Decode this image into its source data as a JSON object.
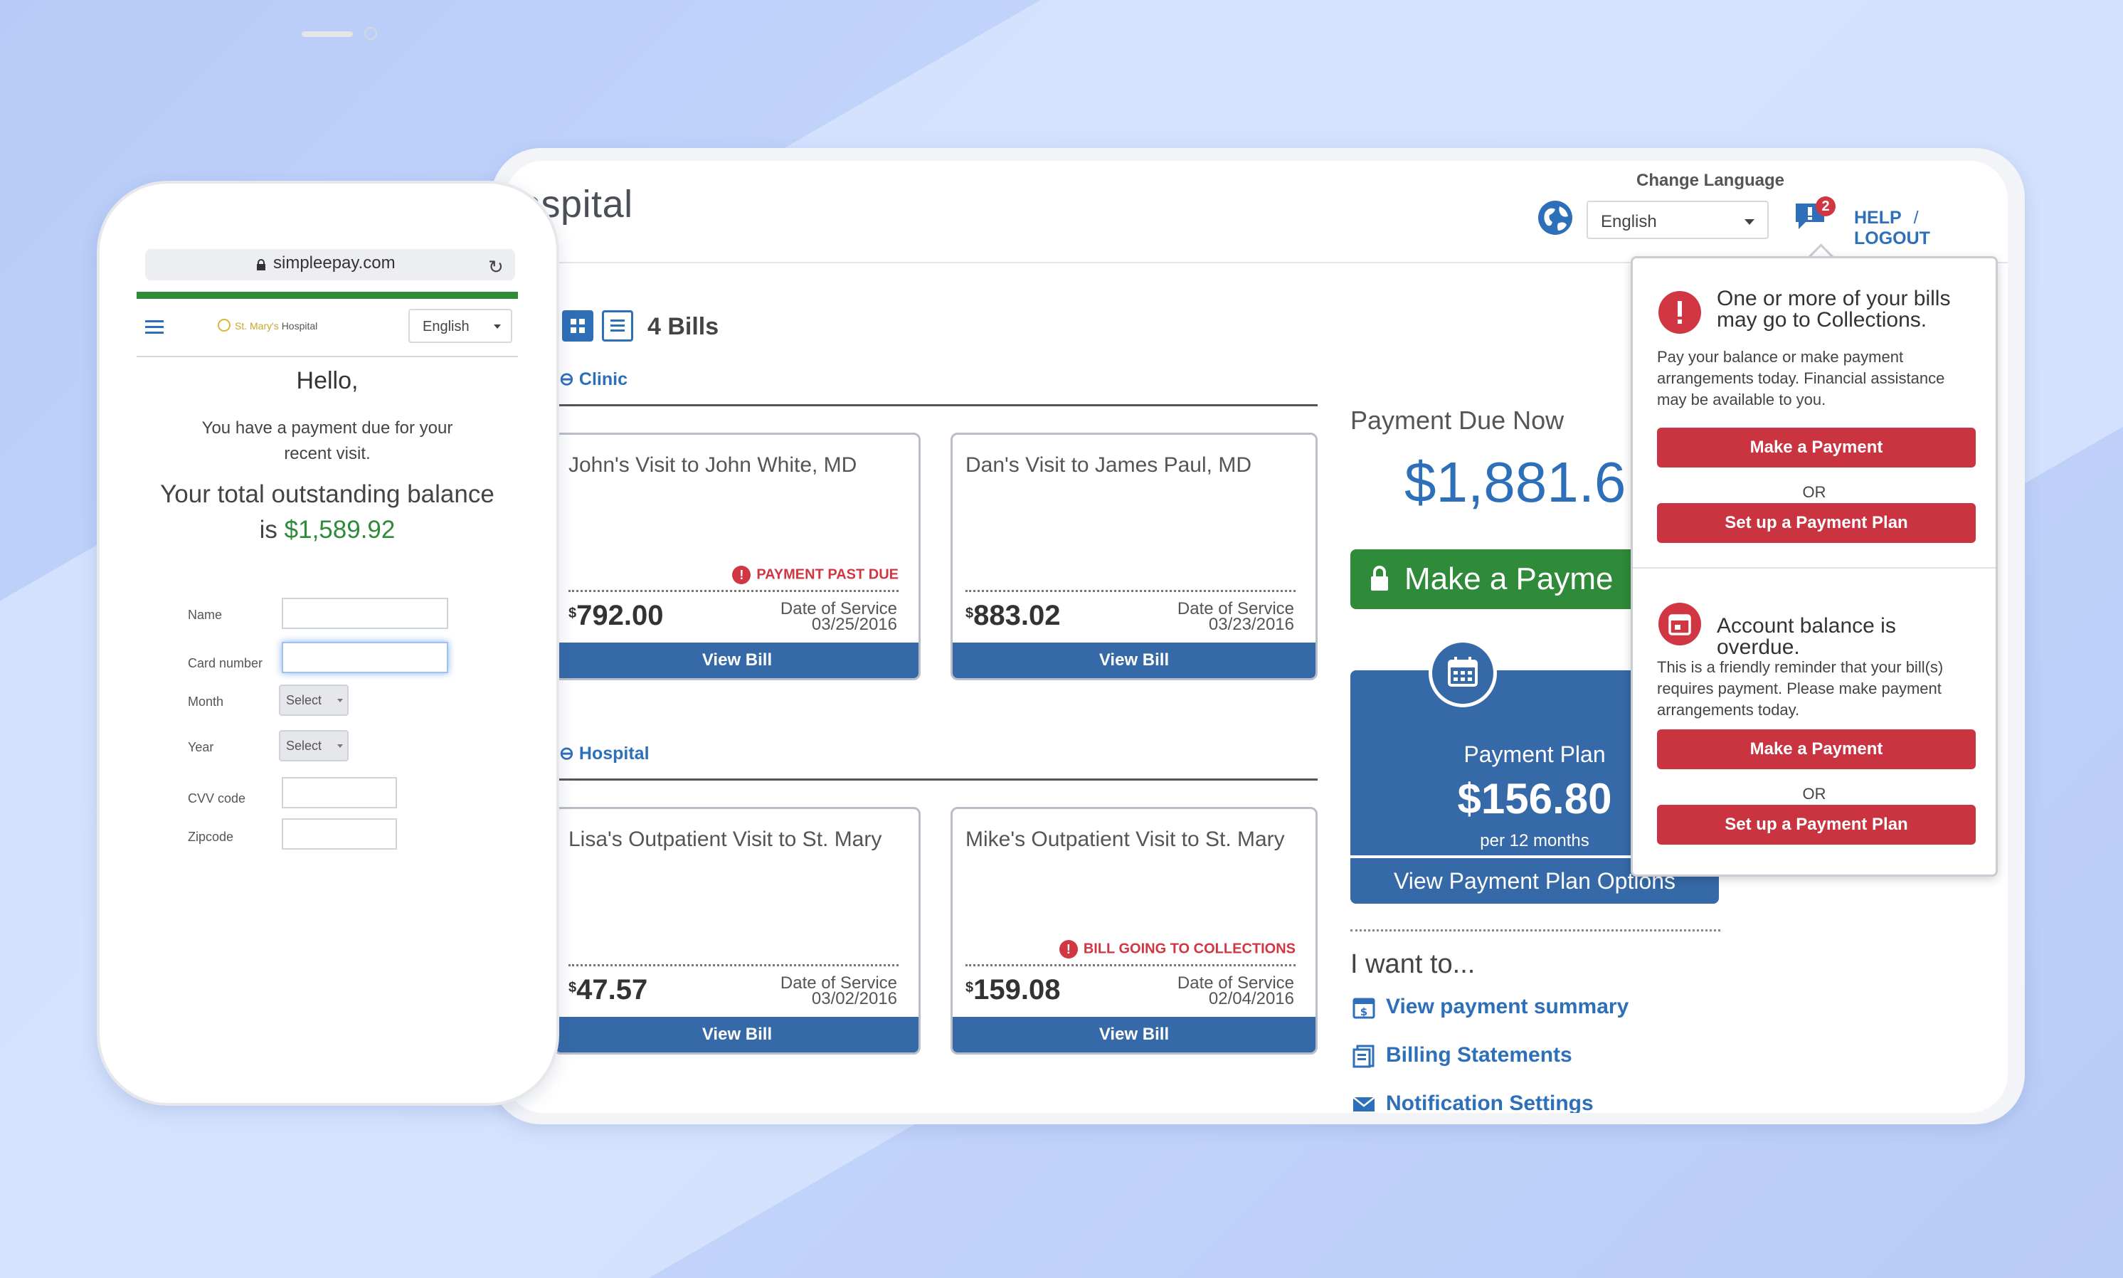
{
  "desktop": {
    "brand": "ospital",
    "change_language_label": "Change Language",
    "language_selected": "English",
    "alert_count": "2",
    "help_label": "HELP",
    "separator": "/",
    "logout_label": "LOGOUT",
    "bills_count": "4 Bills",
    "sections": [
      {
        "label": "Clinic"
      },
      {
        "label": "Hospital"
      }
    ],
    "bills": [
      {
        "title": "John's Visit to John White, MD",
        "flag": "PAYMENT PAST DUE",
        "currency": "$",
        "amount": "792.00",
        "dos_label": "Date of Service",
        "dos": "03/25/2016",
        "button": "View Bill"
      },
      {
        "title": "Dan's Visit to James Paul, MD",
        "flag": "",
        "currency": "$",
        "amount": "883.02",
        "dos_label": "Date of Service",
        "dos": "03/23/2016",
        "button": "View Bill"
      },
      {
        "title": "Lisa's Outpatient Visit to St. Mary",
        "flag": "",
        "currency": "$",
        "amount": "47.57",
        "dos_label": "Date of Service",
        "dos": "03/02/2016",
        "button": "View Bill"
      },
      {
        "title": "Mike's Outpatient Visit to St. Mary",
        "flag": "BILL GOING TO COLLECTIONS",
        "currency": "$",
        "amount": "159.08",
        "dos_label": "Date of Service",
        "dos": "02/04/2016",
        "button": "View Bill"
      }
    ],
    "payment_due": {
      "label": "Payment Due Now",
      "amount": "$1,881.6",
      "button": "Make a Payme"
    },
    "payment_plan": {
      "title": "Payment Plan",
      "amount": "$156.80",
      "per": "per 12 months",
      "options": "View Payment Plan Options"
    },
    "i_want_to": {
      "title": "I want to...",
      "links": [
        "View payment summary",
        "Billing Statements",
        "Notification Settings"
      ]
    },
    "popover": {
      "items": [
        {
          "heading": "One or more of your bills may go to Collections.",
          "text": "Pay your balance or make payment arrangements today. Financial assistance may be available to you.",
          "button1": "Make a Payment",
          "or": "OR",
          "button2": "Set up a Payment Plan"
        },
        {
          "heading": "Account balance is overdue.",
          "text": "This is a friendly reminder that your bill(s) requires payment. Please make payment arrangements today.",
          "button1": "Make a Payment",
          "or": "OR",
          "button2": "Set up a Payment Plan"
        }
      ]
    }
  },
  "phone": {
    "url": "simpleepay.com",
    "logo_prefix": "St. Mary's",
    "logo_suffix": "Hospital",
    "language_selected": "English",
    "hello": "Hello,",
    "subtitle": "You have a payment due for your recent visit.",
    "balance_text": "Your total outstanding balance is",
    "balance_amount": "$1,589.92",
    "form": {
      "name_label": "Name",
      "card_label": "Card number",
      "month_label": "Month",
      "year_label": "Year",
      "cvv_label": "CVV code",
      "zip_label": "Zipcode",
      "select_placeholder": "Select"
    }
  },
  "colors": {
    "brand_blue": "#3669a7",
    "link_blue": "#2e6fba",
    "success_green": "#2f8a3a",
    "alert_red": "#d13643"
  }
}
